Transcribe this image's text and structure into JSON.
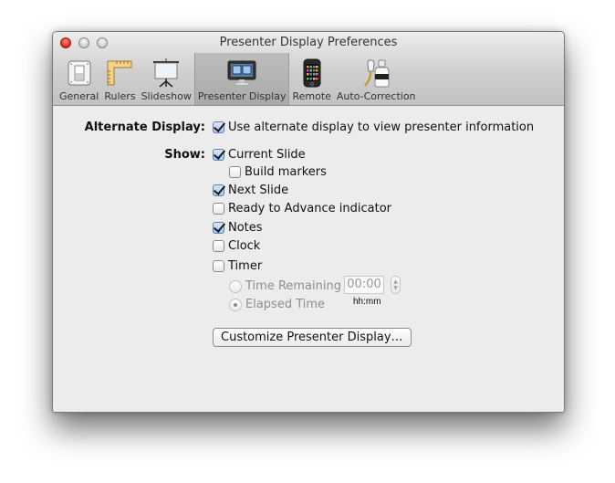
{
  "window": {
    "title": "Presenter Display Preferences"
  },
  "toolbar": {
    "items": [
      {
        "label": "General",
        "icon": "general-switch-icon",
        "selected": false
      },
      {
        "label": "Rulers",
        "icon": "ruler-icon",
        "selected": false
      },
      {
        "label": "Slideshow",
        "icon": "projector-screen-icon",
        "selected": false
      },
      {
        "label": "Presenter Display",
        "icon": "presenter-monitor-icon",
        "selected": true
      },
      {
        "label": "Remote",
        "icon": "iphone-icon",
        "selected": false
      },
      {
        "label": "Auto-Correction",
        "icon": "correction-fluid-icon",
        "selected": false
      }
    ]
  },
  "alternate_display": {
    "label": "Alternate Display:",
    "option": {
      "label": "Use alternate display to view presenter information",
      "checked": true
    }
  },
  "show": {
    "label": "Show:",
    "current_slide": {
      "label": "Current Slide",
      "checked": true
    },
    "build_markers": {
      "label": "Build markers",
      "checked": false
    },
    "next_slide": {
      "label": "Next Slide",
      "checked": true
    },
    "ready_to_advance": {
      "label": "Ready to Advance indicator",
      "checked": false
    },
    "notes": {
      "label": "Notes",
      "checked": true
    },
    "clock": {
      "label": "Clock",
      "checked": false
    },
    "timer": {
      "label": "Timer",
      "checked": false
    }
  },
  "timer_options": {
    "time_remaining": {
      "label": "Time Remaining",
      "selected": false
    },
    "elapsed_time": {
      "label": "Elapsed Time",
      "selected": true
    },
    "time_value": "00:00",
    "time_format": "hh:mm",
    "enabled": false
  },
  "customize_button": {
    "label": "Customize Presenter Display…"
  }
}
